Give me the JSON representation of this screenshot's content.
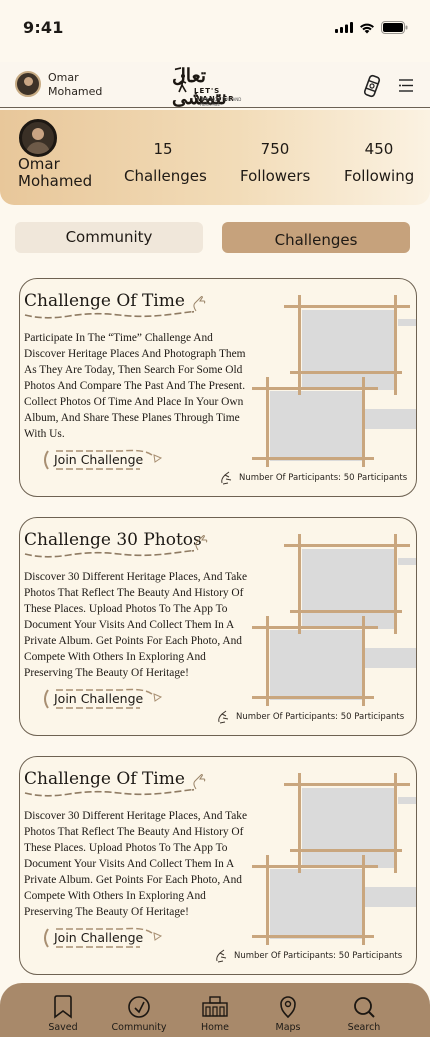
{
  "status": {
    "time": "9:41"
  },
  "header": {
    "username": "Omar Mohamed",
    "username_line1": "Omar",
    "username_line2": "Mohamed",
    "logo_arabic": "تعالَ نتمشى",
    "logo_english": "LET'S WANDER",
    "logo_tagline": "THROUGH TIME AND HERITAGE"
  },
  "profile": {
    "name_line1": "Omar",
    "name_line2": "Mohamed",
    "stats": [
      {
        "value": "15",
        "label": "Challenges"
      },
      {
        "value": "750",
        "label": "Followers"
      },
      {
        "value": "450",
        "label": "Following"
      }
    ]
  },
  "tabs": {
    "community": "Community",
    "challenges": "Challenges",
    "active": "challenges"
  },
  "cards": [
    {
      "title": "Challenge Of Time",
      "description": "Participate In The “Time” Challenge And Discover Heritage Places And Photograph Them As They Are Today, Then Search For Some Old Photos And Compare The Past And The Present. Collect Photos Of Time And Place In Your Own Album, And Share These Planes Through Time With Us.",
      "join_label": "Join  Challenge",
      "participants": "Number Of Participants: 50 Participants"
    },
    {
      "title": "Challenge 30 Photos",
      "description": "Discover 30 Different Heritage Places, And Take Photos That Reflect The Beauty And History Of These Places. Upload Photos To The App To Document Your Visits And Collect Them In A Private Album. Get Points For Each Photo, And Compete With Others In Exploring And Preserving The Beauty Of Heritage!",
      "join_label": "Join  Challenge",
      "participants": "Number Of Participants: 50 Participants"
    },
    {
      "title": "Challenge Of Time",
      "description": "Discover 30 Different Heritage Places, And Take Photos That Reflect The Beauty And History Of These Places. Upload Photos To The App To Document Your Visits And Collect Them In A Private Album. Get Points For Each Photo, And Compete With Others In Exploring And Preserving The Beauty Of Heritage!",
      "join_label": "Join  Challenge",
      "participants": "Number Of Participants: 50 Participants"
    }
  ],
  "nav": [
    {
      "label": "Saved",
      "icon": "bookmark-icon"
    },
    {
      "label": "Community",
      "icon": "compass-icon"
    },
    {
      "label": "Home",
      "icon": "home-icon"
    },
    {
      "label": "Maps",
      "icon": "map-pin-icon"
    },
    {
      "label": "Search",
      "icon": "search-icon"
    }
  ],
  "colors": {
    "accent": "#c6a27c",
    "nav_bg": "#a8896a",
    "frame": "#c9a67e",
    "card_border": "#6e6252"
  }
}
